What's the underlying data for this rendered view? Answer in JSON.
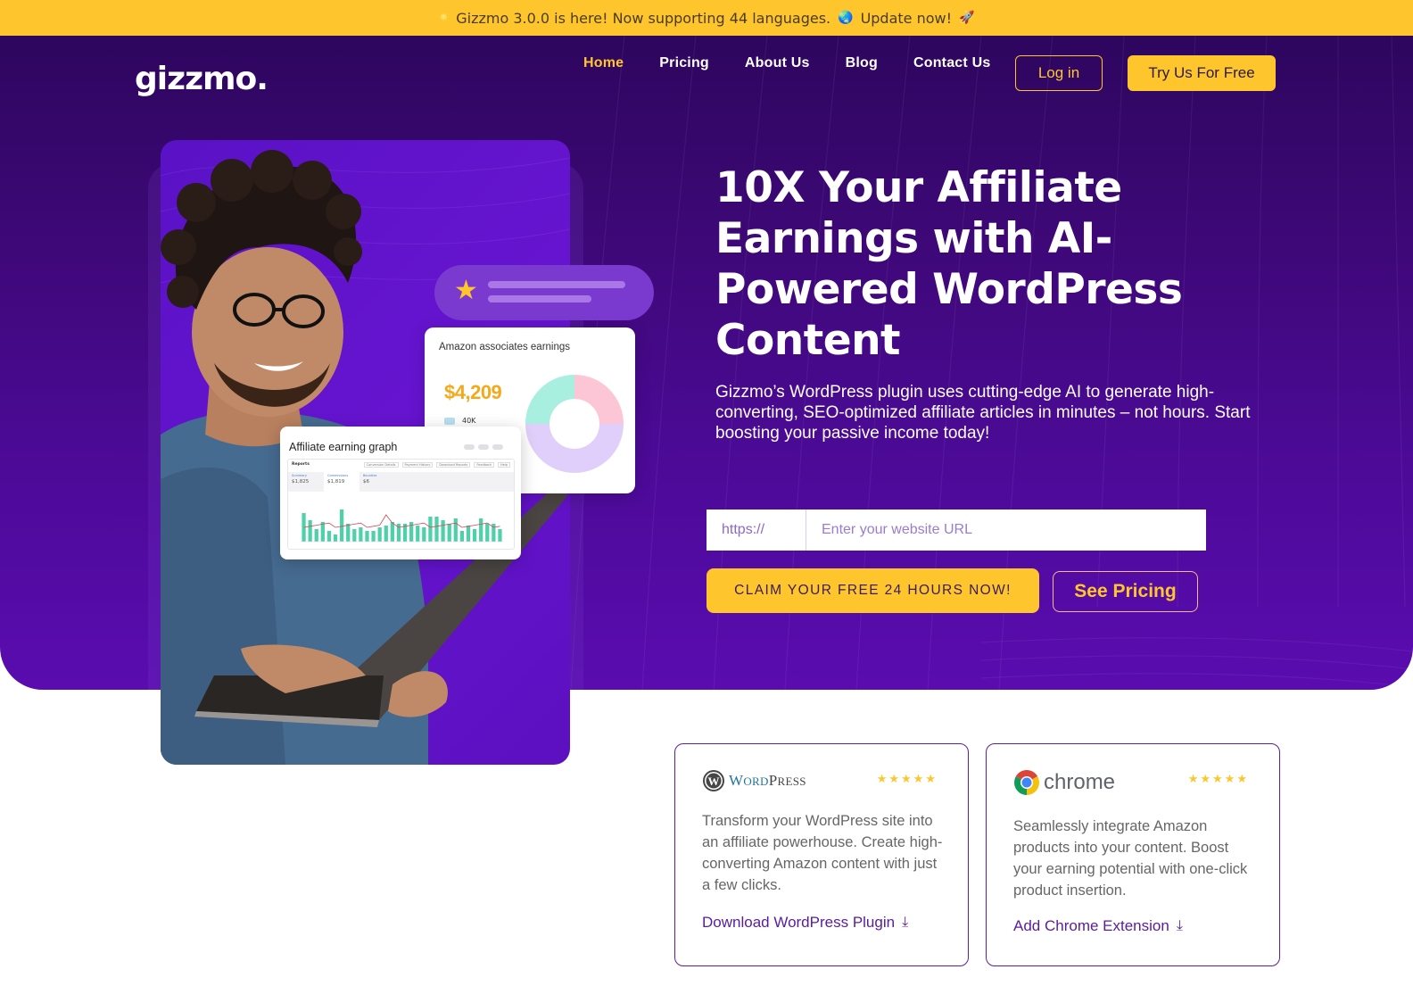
{
  "announcement": {
    "text": "Gizzmo 3.0.0 is here! Now supporting 44 languages.",
    "globe_emoji": "🌏",
    "cta": "Update now!",
    "rocket_emoji": "🚀"
  },
  "header": {
    "logo": "gizzmo.",
    "nav": [
      {
        "label": "Home",
        "active": true
      },
      {
        "label": "Pricing",
        "active": false
      },
      {
        "label": "About Us",
        "active": false
      },
      {
        "label": "Blog",
        "active": false
      },
      {
        "label": "Contact Us",
        "active": false
      }
    ],
    "login_label": "Log in",
    "try_label": "Try Us For Free"
  },
  "hero": {
    "headline": "10X Your Affiliate Earnings with AI-Powered WordPress Content",
    "subtext": "Gizzmo’s WordPress plugin uses cutting-edge AI to generate high-converting, SEO-optimized affiliate articles in minutes – not hours. Start boosting your passive income today!",
    "url_prefix": "https://",
    "url_placeholder": "Enter your website URL",
    "url_value": "",
    "claim_label": "CLAIM YOUR FREE 24 HOURS NOW!",
    "pricing_label": "See Pricing"
  },
  "illustration": {
    "amazon_card": {
      "title": "Amazon associates earnings",
      "amount": "$4,209",
      "legend_value": "40K",
      "donut": [
        {
          "label": "green",
          "value": 25,
          "color": "#a9efe0"
        },
        {
          "label": "pink",
          "value": 25,
          "color": "#fdc6d6"
        },
        {
          "label": "lavender",
          "value": 50,
          "color": "#e0cffa"
        }
      ]
    },
    "graph_card": {
      "title": "Affiliate earning graph",
      "report_title": "Reports",
      "report_tabs": [
        "Conversion Details",
        "Payment History",
        "Download Reports",
        "Feedback",
        "Help"
      ],
      "kpis": [
        {
          "label": "Summary",
          "value": "$1,825"
        },
        {
          "label": "Commissions",
          "value": "$1,819"
        },
        {
          "label": "Bounties",
          "value": "$6"
        }
      ],
      "bars": [
        0.8,
        0.6,
        0.35,
        0.55,
        0.3,
        0.2,
        0.9,
        0.5,
        0.35,
        0.4,
        0.3,
        0.3,
        0.4,
        0.45,
        0.55,
        0.5,
        0.5,
        0.55,
        0.45,
        0.4,
        0.7,
        0.7,
        0.6,
        0.5,
        0.65,
        0.3,
        0.45,
        0.35,
        0.65,
        0.5,
        0.5,
        0.35
      ]
    }
  },
  "cards": [
    {
      "brand": "WordPress",
      "rating": 5,
      "description": "Transform your WordPress site into an affiliate powerhouse. Create high-converting Amazon content with just a few clicks.",
      "link_label": "Download WordPress Plugin"
    },
    {
      "brand": "chrome",
      "rating": 5,
      "description": "Seamlessly integrate Amazon products into your content. Boost your earning potential with one-click product insertion.",
      "link_label": "Add Chrome Extension"
    }
  ],
  "colors": {
    "accent_yellow": "#fec62c",
    "hero_purple_top": "#2d065e",
    "hero_purple_bottom": "#5a0cb0",
    "link_purple": "#5a1c9e"
  }
}
